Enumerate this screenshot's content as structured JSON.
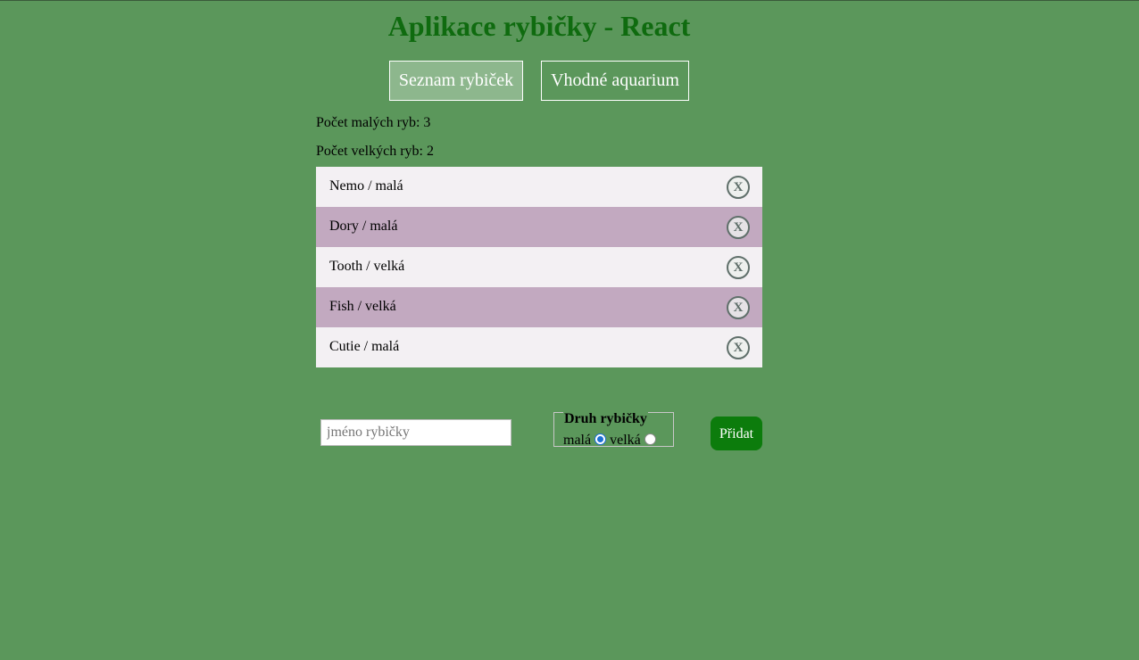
{
  "app": {
    "title": "Aplikace rybičky - React"
  },
  "tabs": [
    {
      "label": "Seznam rybiček",
      "active": true
    },
    {
      "label": "Vhodné aquarium",
      "active": false
    }
  ],
  "counts": {
    "small_text": "Počet malých ryb: 3",
    "big_text": "Počet velkých ryb: 2"
  },
  "fish": [
    {
      "label": "Nemo / malá",
      "delete_label": "X"
    },
    {
      "label": "Dory / malá",
      "delete_label": "X"
    },
    {
      "label": "Tooth / velká",
      "delete_label": "X"
    },
    {
      "label": "Fish / velká",
      "delete_label": "X"
    },
    {
      "label": "Cutie / malá",
      "delete_label": "X"
    }
  ],
  "form": {
    "name_value": "",
    "name_placeholder": "jméno rybičky",
    "legend": "Druh rybičky",
    "options": [
      {
        "label": "malá",
        "checked": true
      },
      {
        "label": "velká",
        "checked": false
      }
    ],
    "submit_label": "Přidat"
  },
  "colors": {
    "background": "#5b975b",
    "title": "#0f6b0f",
    "row_odd": "#f3f0f3",
    "row_even": "#c2a9c0",
    "submit": "#0c7c0c",
    "active_tab": "#8db78d"
  }
}
